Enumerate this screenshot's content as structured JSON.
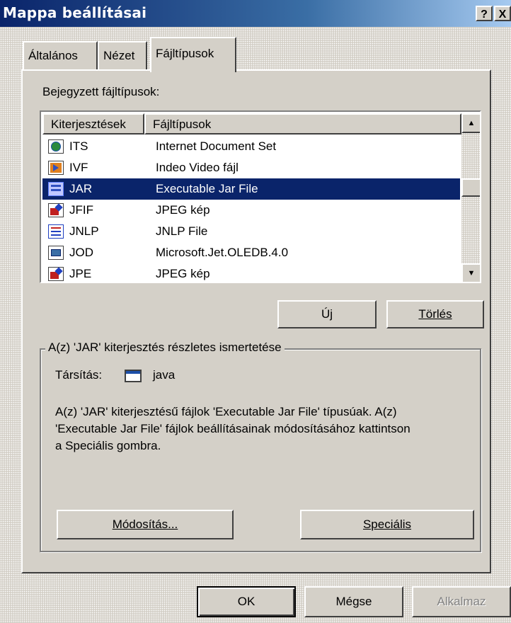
{
  "window": {
    "title": "Mappa beállításai",
    "help_btn": "?",
    "close_btn": "X"
  },
  "tabs": [
    {
      "label": "Általános"
    },
    {
      "label": "Nézet"
    },
    {
      "label": "Fájltípusok",
      "active": true
    }
  ],
  "registered_label": "Bejegyzett fájltípusok:",
  "list": {
    "columns": [
      "Kiterjesztések",
      "Fájltípusok"
    ],
    "rows": [
      {
        "ext": "ITS",
        "type": "Internet Document Set",
        "icon": "globe-doc-icon"
      },
      {
        "ext": "IVF",
        "type": "Indeo Video fájl",
        "icon": "video-file-icon"
      },
      {
        "ext": "JAR",
        "type": "Executable Jar File",
        "icon": "jar-file-icon",
        "selected": true
      },
      {
        "ext": "JFIF",
        "type": "JPEG kép",
        "icon": "image-file-icon"
      },
      {
        "ext": "JNLP",
        "type": "JNLP File",
        "icon": "jnlp-file-icon"
      },
      {
        "ext": "JOD",
        "type": "Microsoft.Jet.OLEDB.4.0",
        "icon": "jod-file-icon"
      },
      {
        "ext": "JPE",
        "type": "JPEG kép",
        "icon": "image-file-icon"
      }
    ]
  },
  "buttons": {
    "new": "Új",
    "delete": "Törlés",
    "modify": "Módosítás...",
    "special": "Speciális",
    "ok": "OK",
    "cancel": "Mégse",
    "apply": "Alkalmaz"
  },
  "details": {
    "legend": "A(z) 'JAR' kiterjesztés részletes ismertetése",
    "assoc_label": "Társítás:",
    "assoc_value": "java",
    "description_lines": [
      "A(z) 'JAR' kiterjesztésű fájlok 'Executable Jar File' típusúak. A(z)",
      "'Executable Jar File' fájlok beállításainak módosításához kattintson",
      "a Speciális gombra."
    ]
  },
  "colors": {
    "title_bar": "#0a246a",
    "selection": "#0a246a",
    "face": "#d4d0c8"
  }
}
